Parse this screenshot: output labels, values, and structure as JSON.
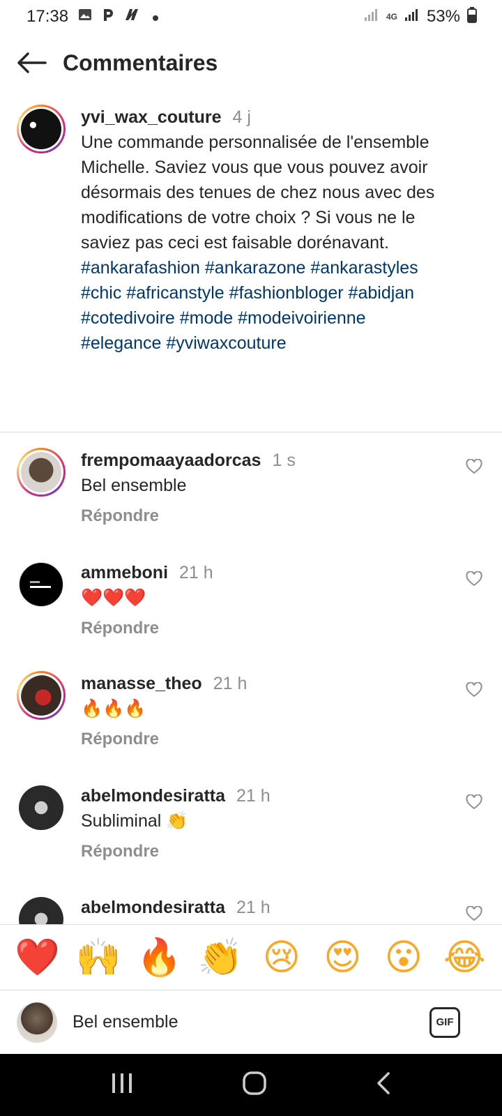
{
  "status": {
    "time": "17:38",
    "network": "4G",
    "battery": "53%"
  },
  "header": {
    "title": "Commentaires"
  },
  "caption": {
    "username": "yvi_wax_couture",
    "time": "4 j",
    "text": "Une commande personnalisée de l'ensemble Michelle. Saviez vous que vous pouvez avoir désormais des tenues de chez nous avec des modifications de votre choix ?  Si vous ne le saviez pas ceci est faisable dorénavant.",
    "hashtags": "#ankarafashion #ankarazone #ankarastyles #chic #africanstyle #fashionbloger #abidjan #cotedivoire #mode #modeivoirienne #elegance #yviwaxcouture"
  },
  "comments": [
    {
      "username": "frempomaayaadorcas",
      "time": "1 s",
      "text": "Bel ensemble",
      "reply": "Répondre"
    },
    {
      "username": "ammeboni",
      "time": "21 h",
      "text": "❤️❤️❤️",
      "reply": "Répondre"
    },
    {
      "username": "manasse_theo",
      "time": "21 h",
      "text": "🔥🔥🔥",
      "reply": "Répondre"
    },
    {
      "username": "abelmondesiratta",
      "time": "21 h",
      "text": "Subliminal 👏",
      "reply": "Répondre"
    },
    {
      "username": "abelmondesiratta",
      "time": "21 h",
      "text": "",
      "reply": ""
    }
  ],
  "emoji_bar": [
    "❤️",
    "🙌",
    "🔥",
    "👏",
    "😢",
    "😍",
    "😮",
    "😂"
  ],
  "compose": {
    "value": "Bel ensemble",
    "gif_label": "GIF"
  },
  "colors": {
    "hashtag": "#00376b",
    "muted": "#8e8e8e",
    "divider": "#dbdbdb"
  }
}
